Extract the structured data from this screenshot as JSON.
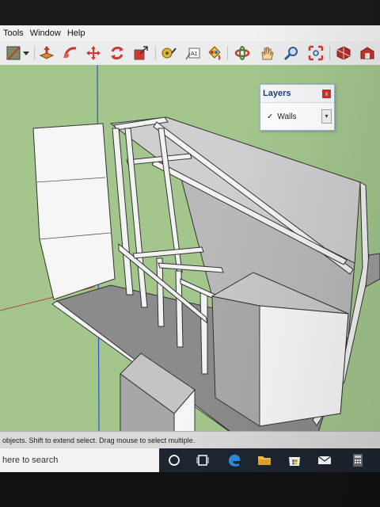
{
  "menu": [
    "Tools",
    "Window",
    "Help"
  ],
  "toolbar": {
    "tools": [
      "select-tool-icon",
      "dropdown-arrow-icon",
      "push-pull-icon",
      "follow-me-icon",
      "move-icon",
      "rotate-icon",
      "scale-icon",
      "tape-measure-icon",
      "text-label-icon",
      "paint-bucket-icon",
      "orbit-icon",
      "pan-icon",
      "zoom-icon",
      "zoom-extents-icon",
      "component-icon",
      "warehouse-icon"
    ],
    "text_tool_label": "A1"
  },
  "layers_panel": {
    "title": "Layers",
    "close_label": "x",
    "current_layer": "Walls",
    "checked": true
  },
  "statusbar": {
    "text": "objects. Shift to extend select. Drag mouse to select multiple."
  },
  "taskbar": {
    "search_placeholder": "here to search",
    "icons": [
      "cortana-icon",
      "task-view-icon",
      "edge-icon",
      "file-explorer-icon",
      "store-icon",
      "mail-icon",
      "calculator-icon"
    ]
  },
  "colors": {
    "viewport_bg": "#a3c68d",
    "taskbar_bg": "#1d2530",
    "layers_title": "#1c3f7a"
  }
}
